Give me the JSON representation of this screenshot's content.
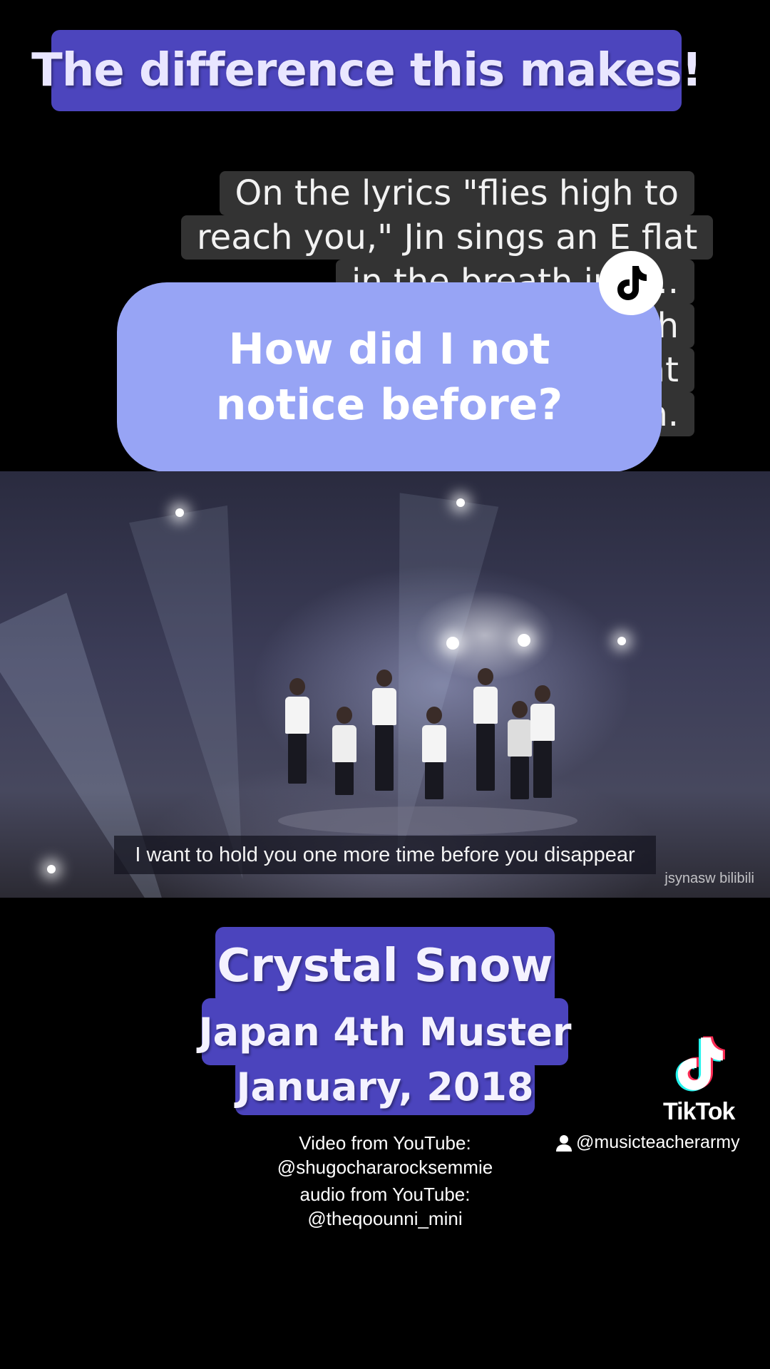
{
  "banner": {
    "text": "The difference this makes!"
  },
  "lyric_note": {
    "lines": [
      "On the lyrics \"flies high to",
      "reach you,\" Jin sings an E flat",
      "in the breath just...",
      "...h",
      "...at",
      "...n."
    ]
  },
  "comment_bubble": {
    "text": "How did I not notice before?"
  },
  "video": {
    "subtitle": "I want to hold you one more time before you disappear",
    "watermark": "jsynasw bilibili"
  },
  "title_card": {
    "title": "Crystal Snow",
    "event": "Japan 4th Muster",
    "date": "January, 2018"
  },
  "credits": {
    "line1": "Video from YouTube:",
    "line2": "@shugochararocksemmie",
    "line3": "audio from YouTube:",
    "line4": "@theqoounni_mini"
  },
  "tiktok": {
    "wordmark": "TikTok",
    "handle": "@musicteacherarmy"
  },
  "colors": {
    "accent": "#4c45bd",
    "bubble": "#97a4f5",
    "lyric_bg": "#333333"
  },
  "icons": [
    "tiktok-note-icon",
    "user-icon"
  ]
}
